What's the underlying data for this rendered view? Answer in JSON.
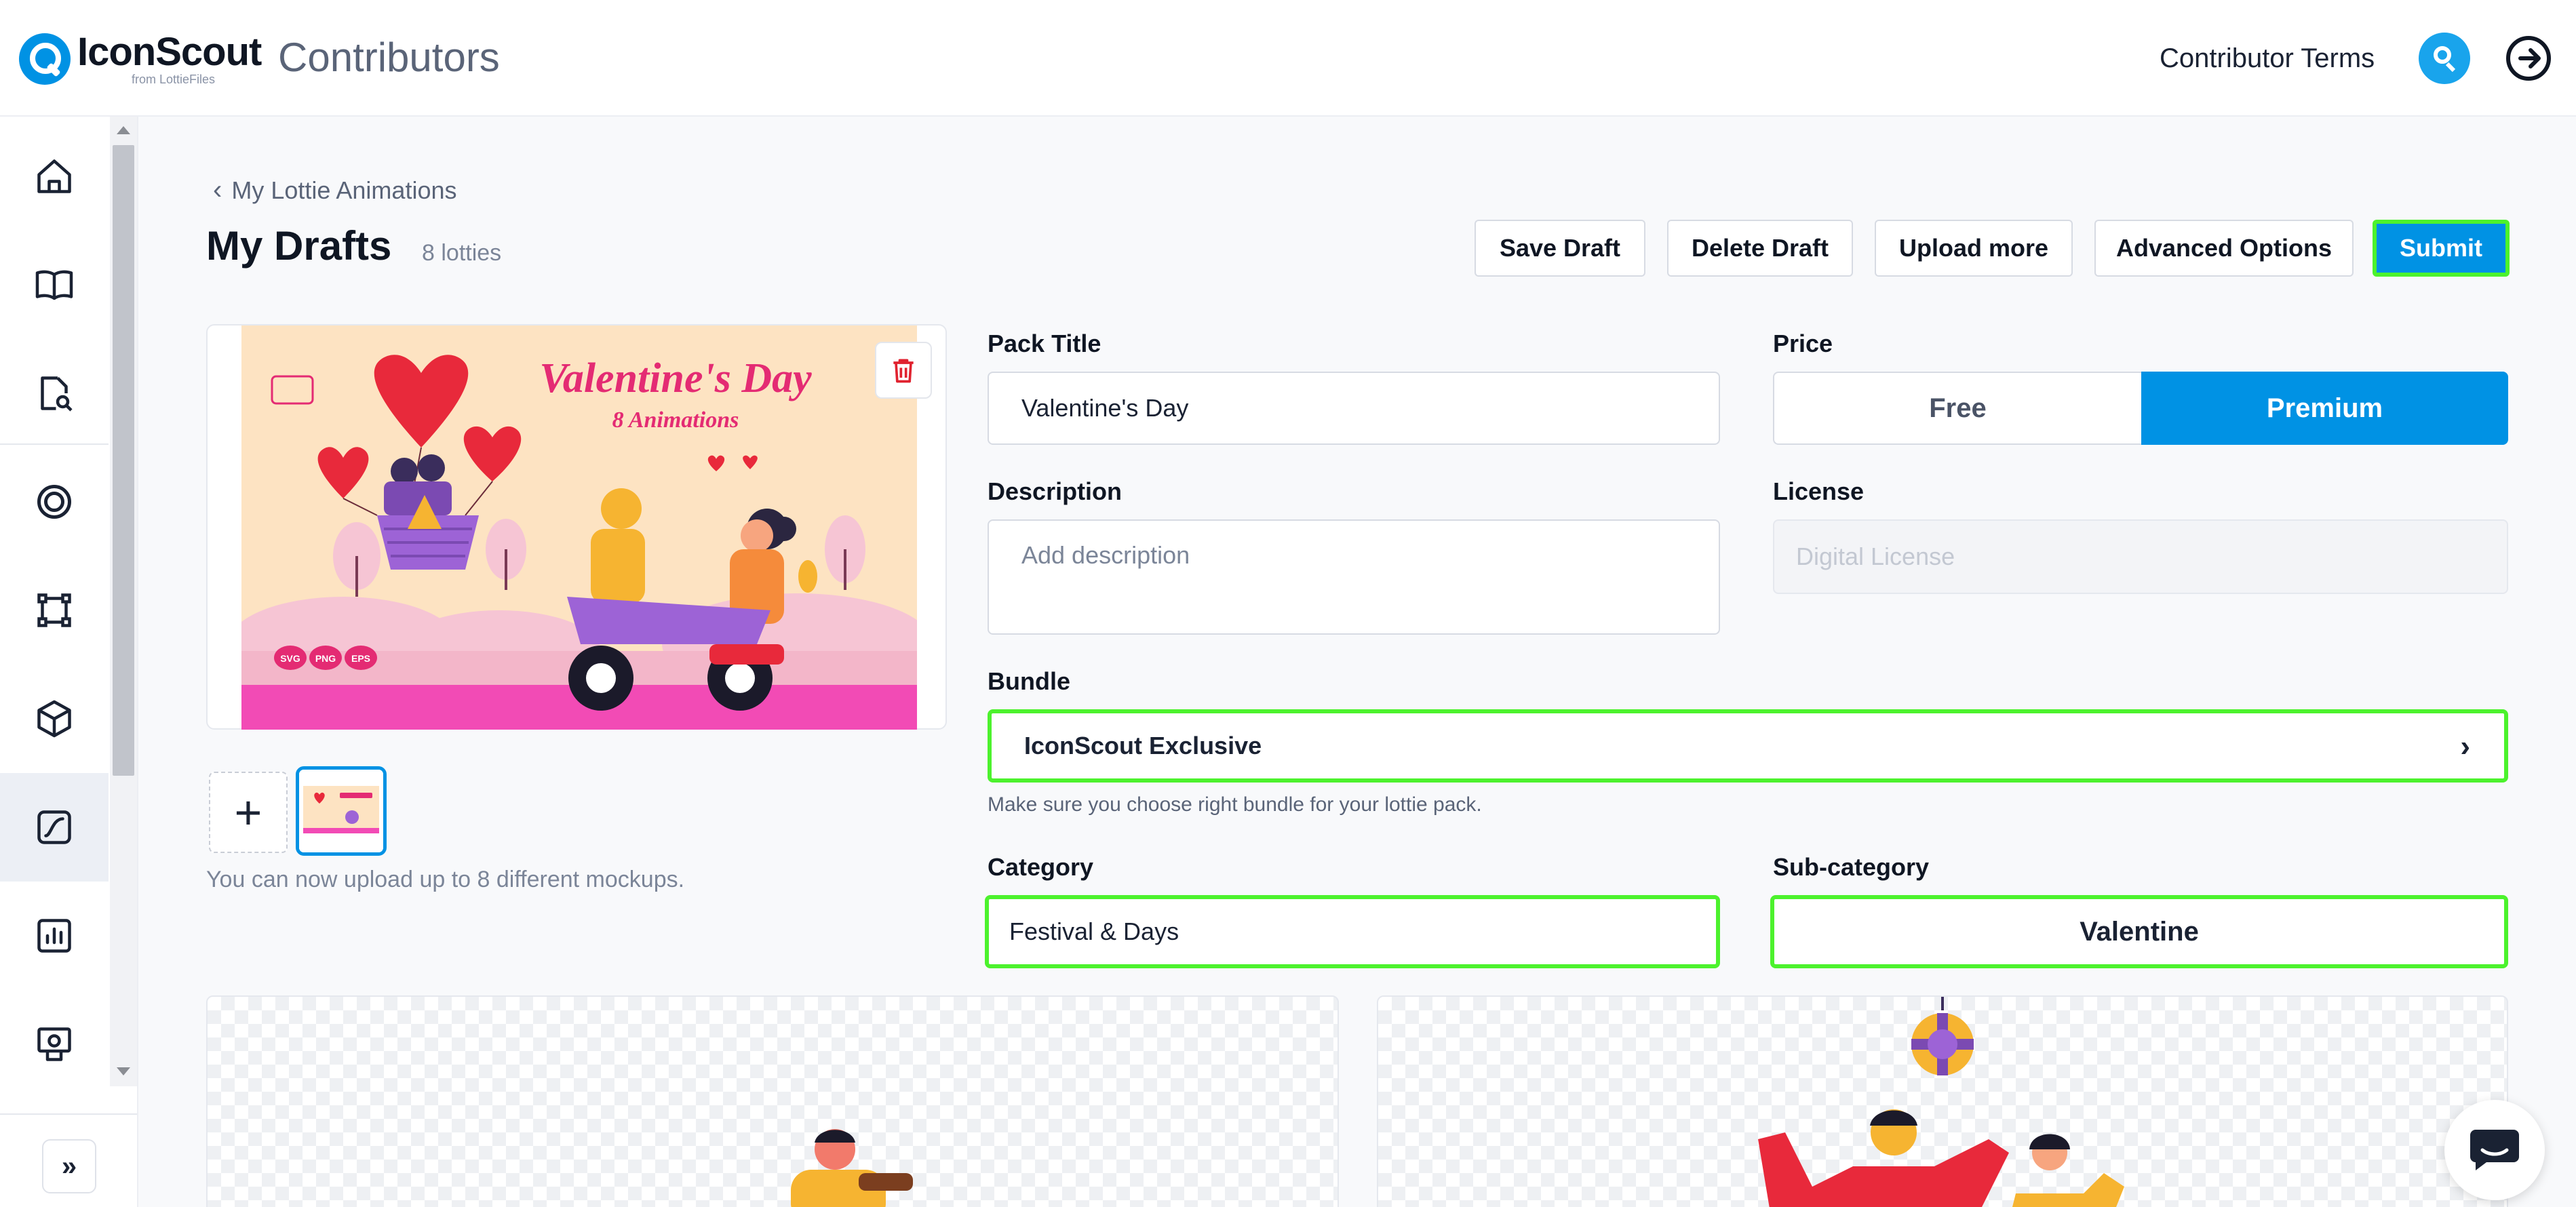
{
  "header": {
    "brand": "IconScout",
    "brand_sub": "from LottieFiles",
    "app_name": "Contributors",
    "contributor_terms": "Contributor Terms"
  },
  "sidebar": {
    "items": [
      {
        "icon": "home-icon"
      },
      {
        "icon": "book-icon"
      },
      {
        "icon": "document-search-icon"
      },
      {
        "icon": "target-icon"
      },
      {
        "icon": "vector-shape-icon"
      },
      {
        "icon": "cube-icon"
      },
      {
        "icon": "lottie-icon",
        "active": true
      },
      {
        "icon": "chart-icon"
      },
      {
        "icon": "store-icon"
      }
    ],
    "expand_label": "»"
  },
  "main": {
    "breadcrumb": "My Lottie Animations",
    "title": "My Drafts",
    "count": "8 lotties",
    "actions": {
      "save_draft": "Save Draft",
      "delete_draft": "Delete Draft",
      "upload_more": "Upload more",
      "advanced_options": "Advanced Options",
      "submit": "Submit"
    },
    "preview": {
      "headline": "Valentine's Day",
      "subline": "8 Animations",
      "formats": [
        "SVG",
        "PNG",
        "EPS"
      ]
    },
    "thumb_hint": "You can now upload up to 8 different mockups.",
    "form": {
      "pack_title_label": "Pack Title",
      "pack_title_value": "Valentine's Day",
      "price_label": "Price",
      "price_free": "Free",
      "price_premium": "Premium",
      "description_label": "Description",
      "description_placeholder": "Add description",
      "license_label": "License",
      "license_placeholder": "Digital License",
      "bundle_label": "Bundle",
      "bundle_value": "IconScout Exclusive",
      "bundle_hint": "Make sure you choose right bundle for your lottie pack.",
      "category_label": "Category",
      "category_value": "Festival & Days",
      "subcategory_label": "Sub-category",
      "subcategory_value": "Valentine"
    }
  },
  "colors": {
    "accent": "#0092e4",
    "highlight": "#4cf22d",
    "danger": "#e0222f"
  }
}
